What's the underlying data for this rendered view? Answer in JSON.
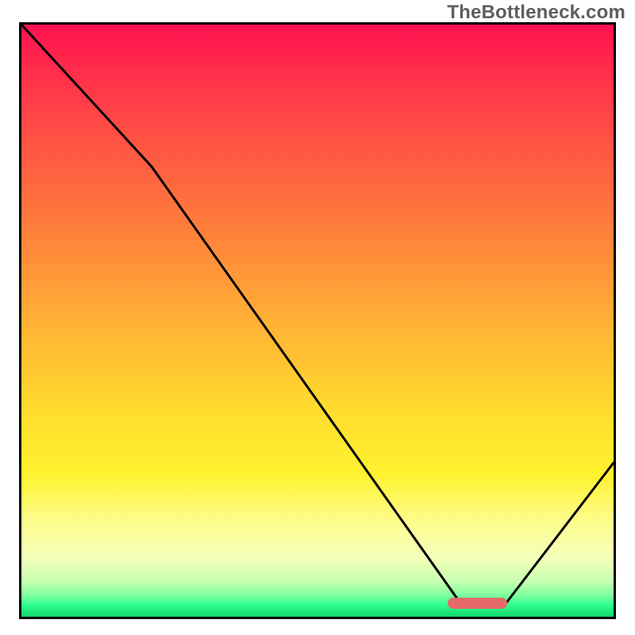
{
  "watermark": "TheBottleneck.com",
  "chart_data": {
    "type": "line",
    "title": "",
    "xlabel": "",
    "ylabel": "",
    "xlim": [
      0,
      100
    ],
    "ylim": [
      0,
      100
    ],
    "grid": false,
    "series": [
      {
        "name": "curve",
        "x": [
          0,
          22,
          74,
          82,
          100
        ],
        "values": [
          100,
          76,
          2.5,
          2.5,
          26
        ]
      }
    ],
    "annotations": [
      {
        "name": "min-marker",
        "x_start": 72,
        "x_end": 82,
        "y": 2.3
      }
    ],
    "gradient_stops": [
      {
        "pos": 0,
        "color": "#ff1150"
      },
      {
        "pos": 0.22,
        "color": "#ff5942"
      },
      {
        "pos": 0.52,
        "color": "#ffb634"
      },
      {
        "pos": 0.76,
        "color": "#fff22f"
      },
      {
        "pos": 0.9,
        "color": "#f5ffba"
      },
      {
        "pos": 0.98,
        "color": "#2fff8e"
      },
      {
        "pos": 1.0,
        "color": "#11d66a"
      }
    ]
  }
}
